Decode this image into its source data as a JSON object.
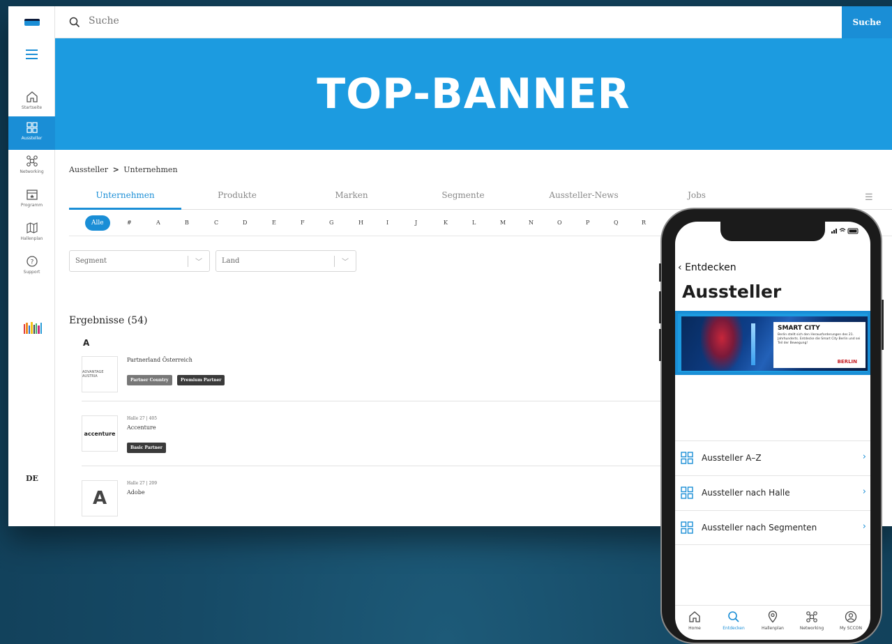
{
  "sidebar": {
    "items": [
      {
        "label": "Startseite",
        "icon": "home-icon"
      },
      {
        "label": "Aussteller",
        "icon": "grid-icon",
        "active": true
      },
      {
        "label": "Networking",
        "icon": "networking-icon"
      },
      {
        "label": "Programm",
        "icon": "calendar-icon"
      },
      {
        "label": "Hallenplan",
        "icon": "map-icon"
      },
      {
        "label": "Support",
        "icon": "question-icon"
      }
    ],
    "language": "DE"
  },
  "search": {
    "placeholder": "Suche",
    "button_label": "Suche"
  },
  "banner": {
    "title": "TOP-BANNER",
    "color": "#1c9be0"
  },
  "breadcrumb": {
    "root": "Aussteller",
    "separator": ">",
    "current": "Unternehmen"
  },
  "tabs": [
    "Unternehmen",
    "Produkte",
    "Marken",
    "Segmente",
    "Aussteller-News",
    "Jobs"
  ],
  "alphabet": [
    "Alle",
    "#",
    "A",
    "B",
    "C",
    "D",
    "E",
    "F",
    "G",
    "H",
    "I",
    "J",
    "K",
    "L",
    "M",
    "N",
    "O",
    "P",
    "Q",
    "R"
  ],
  "filters": {
    "segment": "Segment",
    "country": "Land"
  },
  "results": {
    "heading": "Ergebnisse (54)",
    "group_letter": "A",
    "items": [
      {
        "meta": "",
        "name": "Partnerland Österreich",
        "logo_text": "ADVANTAGE AUSTRIA",
        "tags": [
          "Partner Country",
          "Premium Partner"
        ]
      },
      {
        "meta": "Halle 27 | 405",
        "name": "Accenture",
        "logo_text": "accenture",
        "tags": [
          "Basic Partner"
        ]
      },
      {
        "meta": "Halle 27 | 209",
        "name": "Adobe",
        "logo_text": "A",
        "tags": []
      }
    ]
  },
  "phone": {
    "back_label": "Entdecken",
    "title": "Aussteller",
    "promo": {
      "heading": "SMART CITY",
      "text": "Berlin stellt sich den Herausforderungen des 21. Jahrhunderts. Entdecke die Smart City Berlin und sei Teil der Bewegung!",
      "city": "BERLIN"
    },
    "list": [
      "Aussteller A–Z",
      "Aussteller nach Halle",
      "Aussteller nach Segmenten"
    ],
    "tabbar": [
      {
        "label": "Home",
        "icon": "home-icon"
      },
      {
        "label": "Entdecken",
        "icon": "search-icon",
        "active": true
      },
      {
        "label": "Hallenplan",
        "icon": "location-pin-icon"
      },
      {
        "label": "Networking",
        "icon": "networking-icon"
      },
      {
        "label": "My SCCON",
        "icon": "profile-icon"
      }
    ]
  },
  "colors": {
    "accent": "#1a8ed6",
    "banner": "#1c9be0",
    "berlin_red": "#c51d23"
  }
}
